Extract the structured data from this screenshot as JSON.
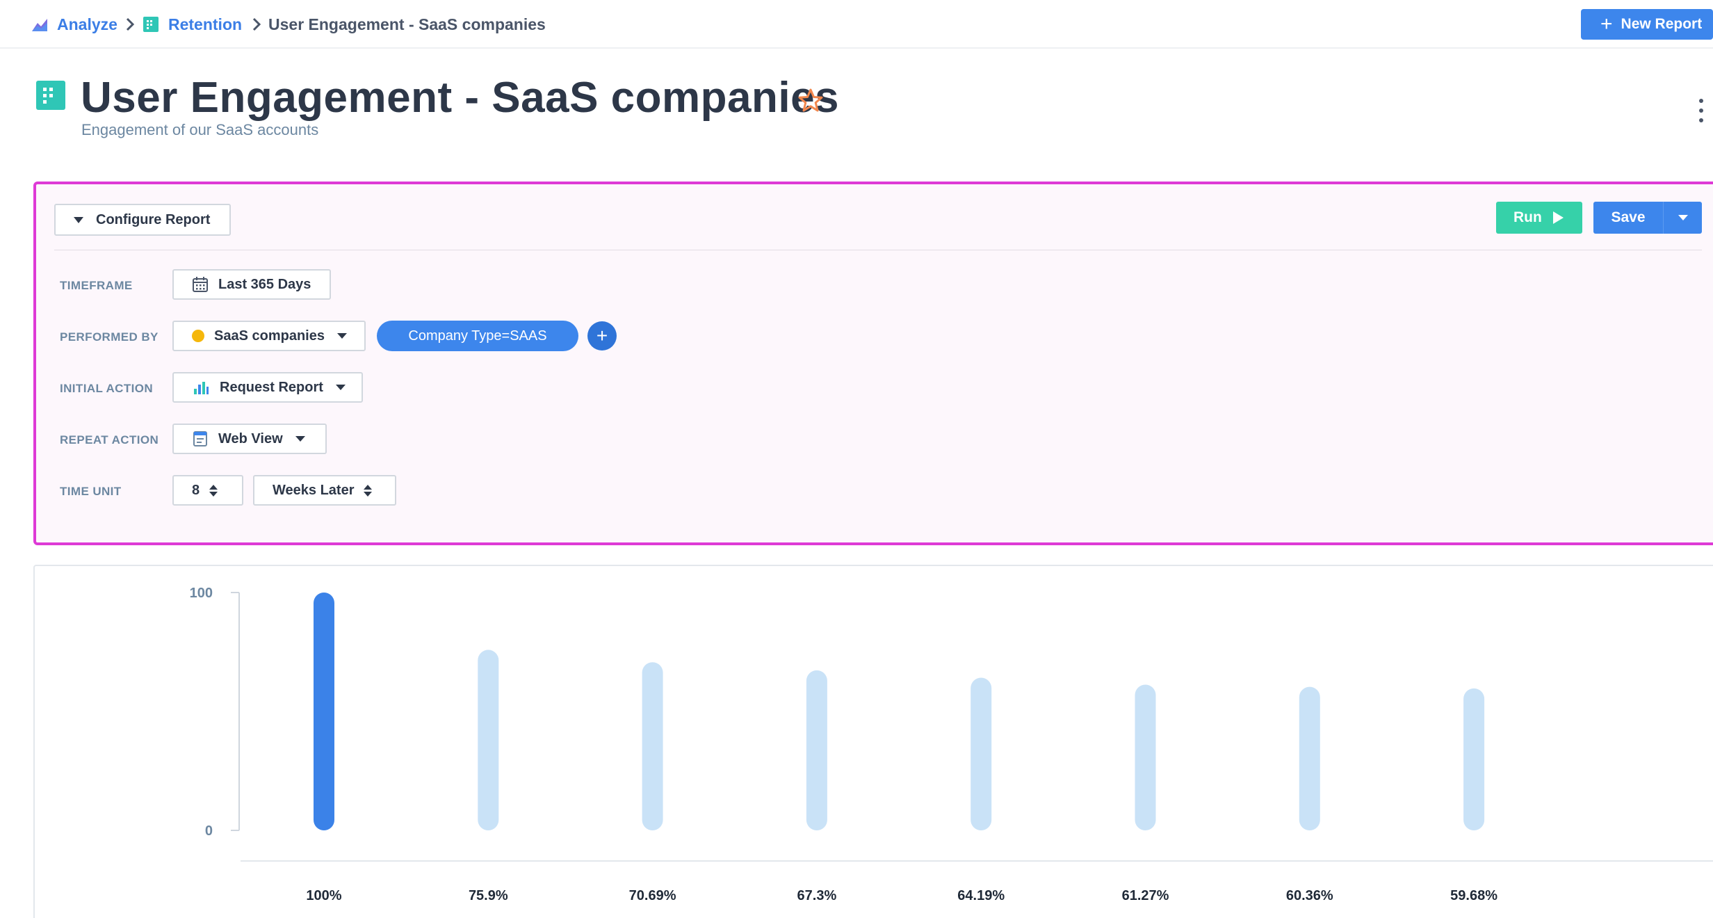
{
  "breadcrumb": {
    "analyze": "Analyze",
    "retention": "Retention",
    "current": "User Engagement - SaaS companies"
  },
  "topbar": {
    "new_report_label": "New Report"
  },
  "header": {
    "title": "User Engagement - SaaS companies",
    "subtitle": "Engagement of our SaaS accounts"
  },
  "config": {
    "configure_label": "Configure Report",
    "run_label": "Run",
    "save_label": "Save",
    "timeframe": {
      "label": "TIMEFRAME",
      "value": "Last 365 Days"
    },
    "performed_by": {
      "label": "PERFORMED BY",
      "value": "SaaS companies",
      "filter_chip": "Company Type=SAAS",
      "add_label": "+"
    },
    "initial_action": {
      "label": "INITIAL ACTION",
      "value": "Request Report"
    },
    "repeat_action": {
      "label": "REPEAT ACTION",
      "value": "Web View"
    },
    "time_unit": {
      "label": "TIME UNIT",
      "count": "8",
      "unit": "Weeks Later"
    }
  },
  "colors": {
    "accent": "#3d86ec",
    "run": "#36d1a9",
    "highlight_border": "#de3ad6",
    "bar_primary": "#3b82e8",
    "bar_secondary": "#c9e2f7"
  },
  "chart_data": {
    "type": "bar",
    "categories": [
      "100%",
      "75.9%",
      "70.69%",
      "67.3%",
      "64.19%",
      "61.27%",
      "60.36%",
      "59.68%"
    ],
    "values": [
      100,
      75.9,
      70.69,
      67.3,
      64.19,
      61.27,
      60.36,
      59.68
    ],
    "y_ticks": [
      "0",
      "100"
    ],
    "ylim": [
      0,
      100
    ],
    "grid": false,
    "legend": "none"
  }
}
